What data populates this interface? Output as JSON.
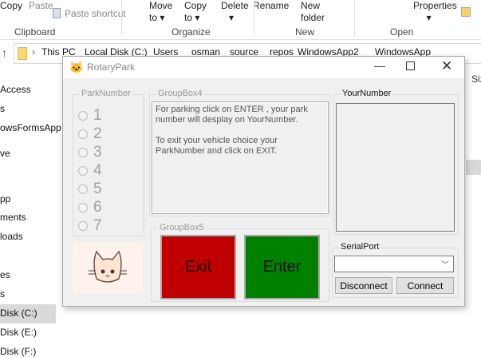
{
  "ribbon": {
    "copy": "Copy",
    "paste": "Paste",
    "paste_shortcut": "Paste shortcut",
    "move_to": "Move to",
    "copy_to": "Copy to",
    "delete": "Delete",
    "rename": "Rename",
    "new_folder": "New folder",
    "properties": "Properties",
    "groups": [
      "Clipboard",
      "Organize",
      "New",
      "Open"
    ]
  },
  "breadcrumb": [
    "This PC",
    "Local Disk (C:)",
    "Users",
    "osman",
    "source",
    "repos",
    "WindowsApp2",
    "WindowsApp"
  ],
  "column_header": "Size",
  "nav": [
    "Access",
    "s",
    "owsFormsApp",
    "ve",
    "pp",
    "ments",
    "loads",
    "es",
    "s",
    "Disk (C:)",
    "Disk (E:)",
    "Disk (F:)"
  ],
  "window": {
    "title": "RotaryPark",
    "park_group": "ParkNumber",
    "park_options": [
      "1",
      "2",
      "3",
      "4",
      "5",
      "6",
      "7"
    ],
    "info_group": "GroupBox4",
    "info_text": "For parking click on ENTER , your park number will desplay on YourNumber.\n\nTo exit your vehicle choice your ParkNumber and click on EXIT.",
    "action_group": "GroupBox5",
    "exit": "Exit",
    "enter": "Enter",
    "your_number_group": "YourNumber",
    "your_number": "",
    "serial_group": "SerialPort",
    "serial_value": "",
    "disconnect": "Disconnect",
    "connect": "Connect"
  },
  "colors": {
    "exit": "#c00000",
    "enter": "#008000"
  }
}
